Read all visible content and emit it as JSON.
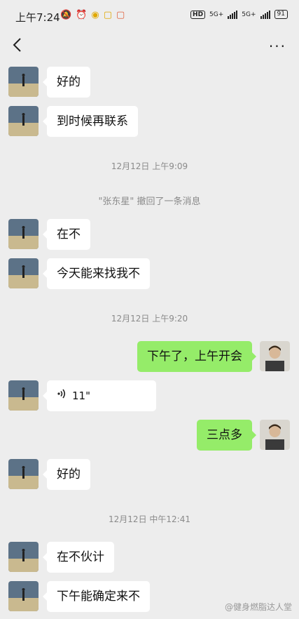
{
  "status_bar": {
    "time": "上午7:24",
    "network_1": "5G+",
    "network_2": "5G+",
    "hd": "HD",
    "battery": "91"
  },
  "timestamps": [
    "12月12日 上午9:09",
    "12月12日 上午9:20",
    "12月12日 中午12:41"
  ],
  "recall_notice": "\"张东星\" 撤回了一条消息",
  "messages": [
    {
      "side": "left",
      "text": "好的"
    },
    {
      "side": "left",
      "text": "到时候再联系"
    },
    {
      "side": "left",
      "text": "在不"
    },
    {
      "side": "left",
      "text": "今天能来找我不"
    },
    {
      "side": "right",
      "text": "下午了，上午开会"
    },
    {
      "side": "left",
      "text": "11\""
    },
    {
      "side": "right",
      "text": "三点多"
    },
    {
      "side": "left",
      "text": "好的"
    },
    {
      "side": "left",
      "text": "在不伙计"
    },
    {
      "side": "left",
      "text": "下午能确定来不"
    }
  ],
  "watermark": "@健身燃脂达人堂",
  "colors": {
    "background": "#ededed",
    "sent_bubble": "#95ec69",
    "received_bubble": "#ffffff"
  }
}
